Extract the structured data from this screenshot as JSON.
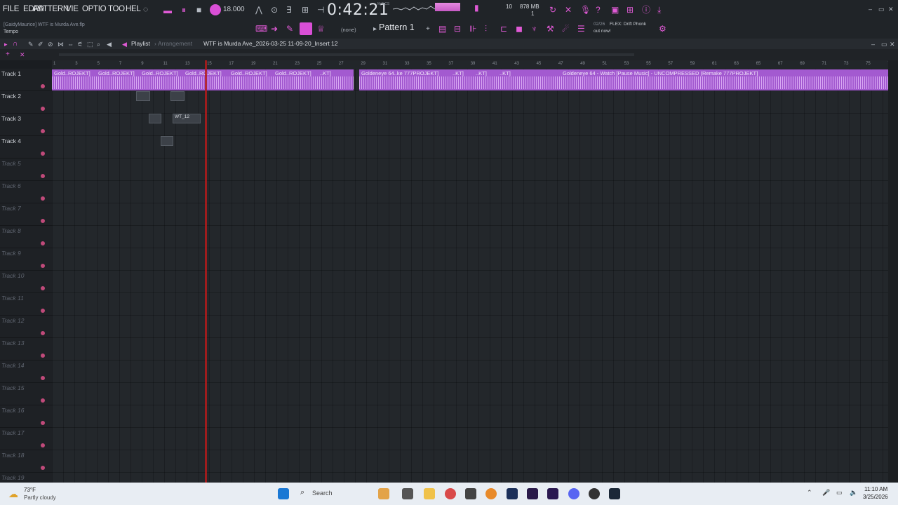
{
  "menu": {
    "file": "FILE",
    "edit": "ED",
    "add": "AD",
    "pattern": "PATTERN",
    "view": "VIE",
    "options": "OPTIO",
    "tools": "TOO",
    "help": "HEL"
  },
  "hint_bar": {
    "project_line": "[GaidyMaurice] WTF is Murda Ave.flp",
    "mode": "Tempo"
  },
  "transport": {
    "tempo": "18.000",
    "time": "0:42:21",
    "time_sub": "M:S:CS",
    "cpu_top": "10",
    "memory": "878 MB",
    "cpu_bottom": "1"
  },
  "pattern_selector": {
    "snap": "(none)",
    "pattern": "Pattern 1"
  },
  "news": {
    "date": "02/26",
    "line1": "FLEX: Drift Phonk",
    "line2": "out now!"
  },
  "playlist": {
    "title": "Playlist",
    "subtitle": "Arrangement",
    "file": "WTF is Murda Ave_2026-03-25 11-09-20_Insert 12"
  },
  "ruler": [
    "1",
    "3",
    "5",
    "7",
    "9",
    "11",
    "13",
    "15",
    "17",
    "19",
    "21",
    "23",
    "25",
    "27",
    "29",
    "31",
    "33",
    "35",
    "37",
    "39",
    "41",
    "43",
    "45",
    "47",
    "49",
    "51",
    "53",
    "55",
    "57",
    "59",
    "61",
    "63",
    "65",
    "67",
    "69",
    "71",
    "73",
    "75",
    "77"
  ],
  "tracks": [
    {
      "name": "Track 1",
      "active": true
    },
    {
      "name": "Track 2",
      "active": true
    },
    {
      "name": "Track 3",
      "active": true
    },
    {
      "name": "Track 4",
      "active": true
    },
    {
      "name": "Track 5",
      "active": false
    },
    {
      "name": "Track 6",
      "active": false
    },
    {
      "name": "Track 7",
      "active": false
    },
    {
      "name": "Track 8",
      "active": false
    },
    {
      "name": "Track 9",
      "active": false
    },
    {
      "name": "Track 10",
      "active": false
    },
    {
      "name": "Track 11",
      "active": false
    },
    {
      "name": "Track 12",
      "active": false
    },
    {
      "name": "Track 13",
      "active": false
    },
    {
      "name": "Track 14",
      "active": false
    },
    {
      "name": "Track 15",
      "active": false
    },
    {
      "name": "Track 16",
      "active": false
    },
    {
      "name": "Track 17",
      "active": false
    },
    {
      "name": "Track 18",
      "active": false
    },
    {
      "name": "Track 19",
      "active": false
    }
  ],
  "clips": {
    "c1": "Gold..ROJEKT]",
    "c2": "Gold..ROJEKT]",
    "c3": "Gold..ROJEKT]",
    "c4": "Gold..ROJEKT]",
    "c5": "Gold..ROJEKT]",
    "c6": "Gold..ROJEKT]",
    "c7": "..KT]",
    "c8": "Goldeneye 64..ke 777PROJEKT]",
    "c9": "..KT]",
    "c10": "..KT]",
    "c11": "..KT]",
    "c12": "Goldeneye 64 - Watch [Pause Music] - UNCOMPRESSED (Remake 777PROJEKT]",
    "wt": "WT_12"
  },
  "taskbar": {
    "temp": "73°F",
    "weather": "Partly cloudy",
    "search": "Search",
    "clock": "11:10 AM",
    "date": "3/25/2026"
  },
  "colors": {
    "accent": "#d94fd6",
    "clip": "#a35ad0",
    "playhead": "#b31b1b"
  }
}
